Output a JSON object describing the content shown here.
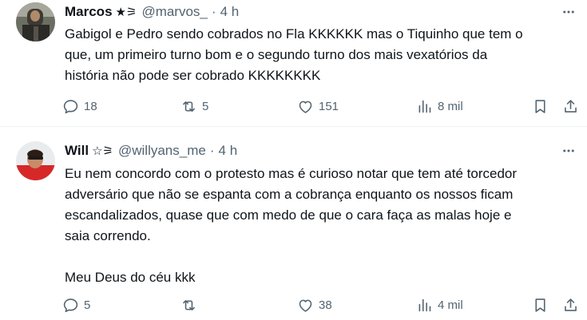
{
  "tweets": [
    {
      "name": "Marcos",
      "badge": "★⚞",
      "handle": "@marvos_",
      "separator": "·",
      "time": "4 h",
      "text": "Gabigol e Pedro sendo cobrados no Fla KKKKKK mas o Tiquinho que tem o\nque, um primeiro turno bom e o segundo turno dos mais vexatórios da\nhistória não pode ser cobrado KKKKKKKK",
      "replies": "18",
      "retweets": "5",
      "likes": "151",
      "views": "8 mil"
    },
    {
      "name": "Will",
      "badge": "☆⚞",
      "handle": "@willyans_me",
      "separator": "·",
      "time": "4 h",
      "text": "Eu nem concordo com o protesto mas é curioso notar que tem até torcedor\nadversário que não se espanta com a cobrança enquanto os nossos ficam\nescandalizados, quase que com medo de que o cara faça as malas hoje e\nsaia correndo.\n\nMeu Deus do céu kkk",
      "replies": "5",
      "retweets": "",
      "likes": "38",
      "views": "4 mil"
    }
  ],
  "icons": {
    "more": "more-horizontal-icon",
    "reply": "reply-icon",
    "retweet": "retweet-icon",
    "like": "heart-icon",
    "views": "views-chart-icon",
    "bookmark": "bookmark-icon",
    "share": "share-icon"
  },
  "colors": {
    "text": "#0f1419",
    "secondary": "#536471",
    "divider": "#eff3f4"
  }
}
